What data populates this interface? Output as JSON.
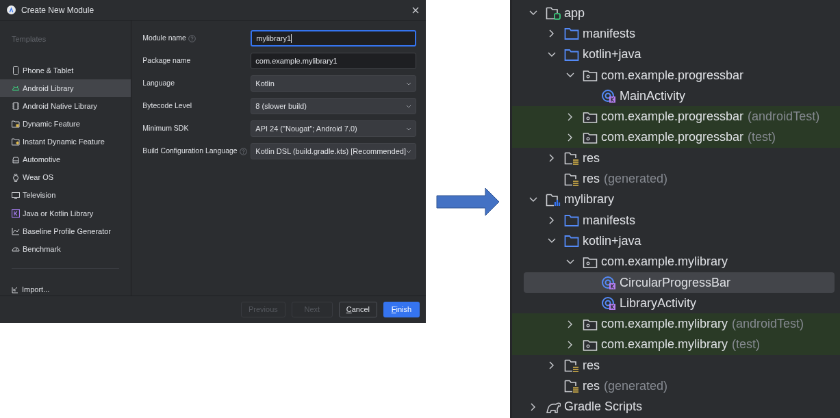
{
  "dialog": {
    "title": "Create New Module",
    "sidebar": {
      "heading": "Templates",
      "items": [
        {
          "label": "Phone & Tablet",
          "selected": false
        },
        {
          "label": "Android Library",
          "selected": true
        },
        {
          "label": "Android Native Library",
          "selected": false
        },
        {
          "label": "Dynamic Feature",
          "selected": false
        },
        {
          "label": "Instant Dynamic Feature",
          "selected": false
        },
        {
          "label": "Automotive",
          "selected": false
        },
        {
          "label": "Wear OS",
          "selected": false
        },
        {
          "label": "Television",
          "selected": false
        },
        {
          "label": "Java or Kotlin Library",
          "selected": false
        },
        {
          "label": "Baseline Profile Generator",
          "selected": false
        },
        {
          "label": "Benchmark",
          "selected": false
        }
      ],
      "import": "Import..."
    },
    "form": [
      {
        "label": "Module name",
        "help": true,
        "kind": "text",
        "value": "mylibrary1",
        "focused": true
      },
      {
        "label": "Package name",
        "help": false,
        "kind": "text",
        "value": "com.example.mylibrary1",
        "focused": false
      },
      {
        "label": "Language",
        "help": false,
        "kind": "dropdown",
        "value": "Kotlin",
        "focused": false
      },
      {
        "label": "Bytecode Level",
        "help": false,
        "kind": "dropdown",
        "value": "8 (slower build)",
        "focused": false
      },
      {
        "label": "Minimum SDK",
        "help": false,
        "kind": "dropdown",
        "value": "API 24 (\"Nougat\"; Android 7.0)",
        "focused": false
      },
      {
        "label": "Build Configuration Language",
        "help": true,
        "kind": "dropdown",
        "value": "Kotlin DSL (build.gradle.kts) [Recommended]",
        "focused": false
      }
    ],
    "buttons": [
      {
        "label": "Previous",
        "disabled": true,
        "primary": false,
        "mnemonic": false
      },
      {
        "label": "Next",
        "disabled": true,
        "primary": false,
        "mnemonic": false
      },
      {
        "label": "Cancel",
        "disabled": false,
        "primary": false,
        "mnemonic": true
      },
      {
        "label": "Finish",
        "disabled": false,
        "primary": true,
        "mnemonic": true
      }
    ]
  },
  "project_tree": [
    {
      "kind": "app_module",
      "label": "app",
      "expanded": true,
      "highlighted": false,
      "selected": false,
      "children": [
        {
          "kind": "folder",
          "label": "manifests",
          "expanded": false,
          "highlighted": false,
          "selected": false
        },
        {
          "kind": "folder",
          "label": "kotlin+java",
          "expanded": true,
          "highlighted": false,
          "selected": false,
          "children": [
            {
              "kind": "package",
              "label": "com.example.progressbar",
              "expanded": true,
              "highlighted": false,
              "selected": false,
              "children": [
                {
                  "kind": "class",
                  "label": "MainActivity",
                  "highlighted": false,
                  "selected": false
                }
              ]
            },
            {
              "kind": "package",
              "label": "com.example.progressbar",
              "suffix": "(androidTest)",
              "expanded": false,
              "highlighted": true,
              "selected": false
            },
            {
              "kind": "package",
              "label": "com.example.progressbar",
              "suffix": "(test)",
              "expanded": false,
              "highlighted": true,
              "selected": false
            }
          ]
        },
        {
          "kind": "res",
          "label": "res",
          "expanded": false,
          "highlighted": false,
          "selected": false
        },
        {
          "kind": "res",
          "label": "res",
          "suffix": "(generated)",
          "highlighted": false,
          "selected": false
        }
      ]
    },
    {
      "kind": "library_module",
      "label": "mylibrary",
      "expanded": true,
      "highlighted": false,
      "selected": false,
      "children": [
        {
          "kind": "folder",
          "label": "manifests",
          "expanded": false,
          "highlighted": false,
          "selected": false
        },
        {
          "kind": "folder",
          "label": "kotlin+java",
          "expanded": true,
          "highlighted": false,
          "selected": false,
          "children": [
            {
              "kind": "package",
              "label": "com.example.mylibrary",
              "expanded": true,
              "highlighted": false,
              "selected": false,
              "children": [
                {
                  "kind": "class",
                  "label": "CircularProgressBar",
                  "highlighted": false,
                  "selected": true
                },
                {
                  "kind": "class",
                  "label": "LibraryActivity",
                  "highlighted": false,
                  "selected": false
                }
              ]
            },
            {
              "kind": "package",
              "label": "com.example.mylibrary",
              "suffix": "(androidTest)",
              "expanded": false,
              "highlighted": true,
              "selected": false
            },
            {
              "kind": "package",
              "label": "com.example.mylibrary",
              "suffix": "(test)",
              "expanded": false,
              "highlighted": true,
              "selected": false
            }
          ]
        },
        {
          "kind": "res",
          "label": "res",
          "expanded": false,
          "highlighted": false,
          "selected": false
        },
        {
          "kind": "res",
          "label": "res",
          "suffix": "(generated)",
          "highlighted": false,
          "selected": false
        }
      ]
    },
    {
      "kind": "gradle",
      "label": "Gradle Scripts",
      "expanded": false,
      "highlighted": false,
      "selected": false
    }
  ]
}
